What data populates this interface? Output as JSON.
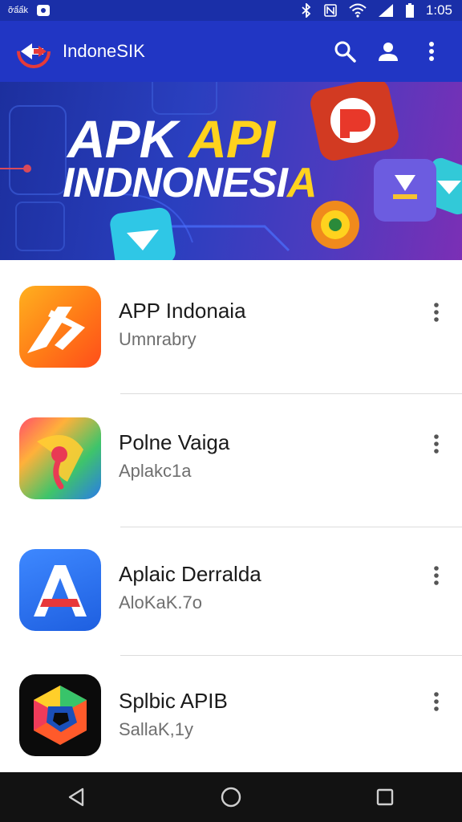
{
  "status_bar": {
    "left_text": "ỡẩẩk",
    "time": "1:05",
    "icons": [
      "bluetooth-icon",
      "nfc-icon",
      "wifi-icon",
      "signal-icon",
      "battery-icon"
    ]
  },
  "app_bar": {
    "title": "IndoneSIK",
    "actions": [
      "search-icon",
      "account-icon",
      "more-vert-icon"
    ],
    "color": "#2136c4"
  },
  "banner": {
    "line1_a": "APK",
    "line1_b": "API",
    "line2_a": "INDNONESI",
    "line2_b": "A",
    "accent": "#ffd21e"
  },
  "apps": [
    {
      "name": "APP Indonaia",
      "subtitle": "Umnrabry"
    },
    {
      "name": "Polne Vaiga",
      "subtitle": "Aplakc1a"
    },
    {
      "name": "Aplaic Derralda",
      "subtitle": "AloKaK.7o"
    },
    {
      "name": "Splbic APIB",
      "subtitle": "SallaK,1y"
    }
  ],
  "nav_bar": {
    "buttons": [
      "back-icon",
      "home-icon",
      "recents-icon"
    ]
  }
}
